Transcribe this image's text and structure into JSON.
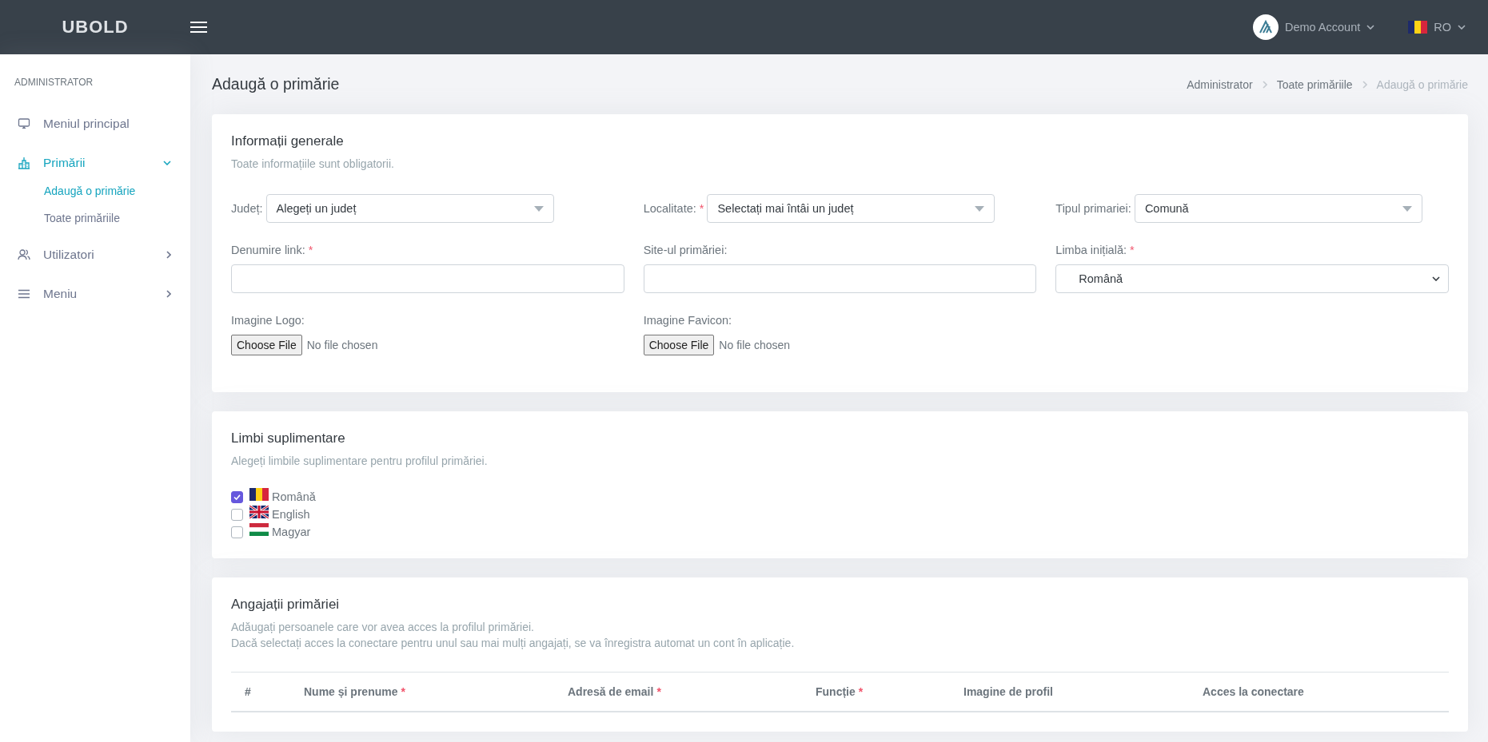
{
  "topbar": {
    "logo": "UBOLD",
    "account": "Demo Account",
    "language": "RO"
  },
  "sidebar": {
    "section": "ADMINISTRATOR",
    "items": [
      {
        "kind": "link",
        "label": "Meniul principal",
        "selected": false
      },
      {
        "kind": "group",
        "label": "Primării",
        "selected": true,
        "expanded": true,
        "children": [
          {
            "label": "Adaugă o primărie",
            "selected": true
          },
          {
            "label": "Toate primăriile",
            "selected": false
          }
        ]
      },
      {
        "kind": "group",
        "label": "Utilizatori",
        "selected": false,
        "expanded": false
      },
      {
        "kind": "group",
        "label": "Meniu",
        "selected": false,
        "expanded": false
      }
    ]
  },
  "page": {
    "title": "Adaugă o primărie",
    "breadcrumb": [
      {
        "label": "Administrator",
        "selected": false
      },
      {
        "label": "Toate primăriile",
        "selected": false
      },
      {
        "label": "Adaugă o primărie",
        "selected": true
      }
    ]
  },
  "general": {
    "title": "Informații generale",
    "subtitle": "Toate informațiile sunt obligatorii.",
    "fields": [
      {
        "kind": "inline-select",
        "label": "Județ:",
        "value": "Alegeți un județ"
      },
      {
        "kind": "inline-select",
        "label": "Localitate:",
        "mark": "*",
        "value": "Selectați mai întâi un județ"
      },
      {
        "kind": "inline-select",
        "label": "Tipul primariei:",
        "value": "Comună"
      },
      {
        "kind": "input",
        "label": "Denumire link:",
        "mark": "*"
      },
      {
        "kind": "input",
        "label": "Site-ul primăriei:"
      },
      {
        "kind": "native-select",
        "label": "Limba inițială:",
        "mark": "*",
        "value": "Română"
      },
      {
        "kind": "file",
        "label": "Imagine Logo:",
        "button": "Choose File",
        "status": "No file chosen"
      },
      {
        "kind": "file",
        "label": "Imagine Favicon:",
        "button": "Choose File",
        "status": "No file chosen"
      }
    ]
  },
  "languages": {
    "title": "Limbi suplimentare",
    "subtitle": "Alegeți limbile suplimentare pentru profilul primăriei.",
    "items": [
      {
        "label": "Română",
        "checked": true
      },
      {
        "label": "English",
        "checked": false
      },
      {
        "label": "Magyar",
        "checked": false
      }
    ]
  },
  "staff": {
    "title": "Angajații primăriei",
    "subtitle": [
      "Adăugați persoanele care vor avea acces la profilul primăriei.",
      "Dacă selectați acces la conectare pentru unul sau mai mulți angajați, se va înregistra automat un cont în aplicație."
    ],
    "table": {
      "columns": [
        {
          "label": "#"
        },
        {
          "label": "Nume și prenume",
          "mark": "*"
        },
        {
          "label": "Adresă de email",
          "mark": "*"
        },
        {
          "label": "Funcție",
          "mark": "*"
        },
        {
          "label": "Imagine de profil"
        },
        {
          "label": "Acces la conectare"
        }
      ]
    }
  }
}
